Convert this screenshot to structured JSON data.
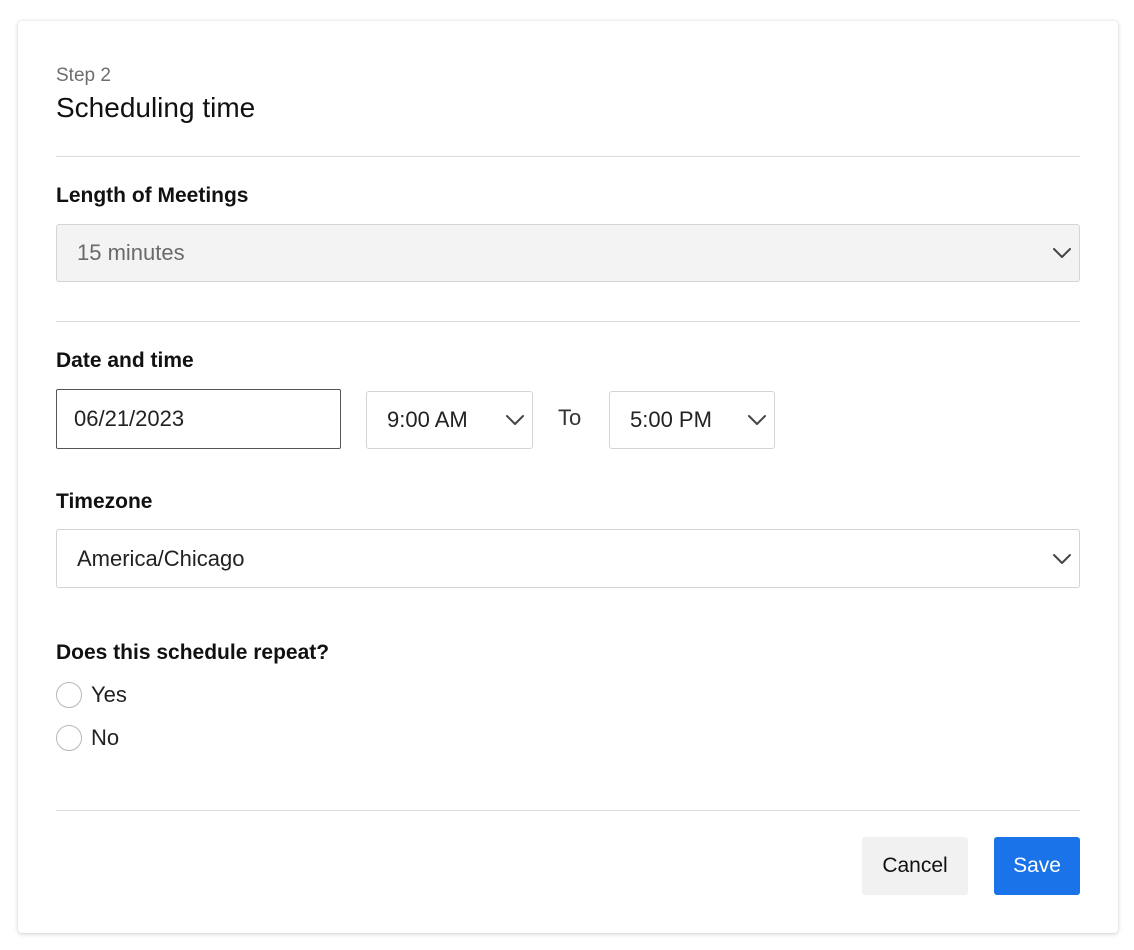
{
  "header": {
    "step": "Step 2",
    "title": "Scheduling time"
  },
  "meeting_length": {
    "label": "Length of Meetings",
    "selected": "15 minutes",
    "disabled": true
  },
  "date_time": {
    "label": "Date and time",
    "date_value": "06/21/2023",
    "start_time": "9:00 AM",
    "separator": "To",
    "end_time": "5:00 PM"
  },
  "timezone": {
    "label": "Timezone",
    "selected": "America/Chicago"
  },
  "repeat": {
    "question": "Does this schedule repeat?",
    "options": [
      {
        "label": "Yes",
        "checked": false
      },
      {
        "label": "No",
        "checked": false
      }
    ]
  },
  "footer": {
    "cancel_label": "Cancel",
    "save_label": "Save"
  },
  "icons": {
    "dropdown": "chevron-down-icon"
  },
  "colors": {
    "primary": "#1a73e8",
    "secondary_button_bg": "#f1f1f1",
    "disabled_field_bg": "#f3f3f3"
  }
}
